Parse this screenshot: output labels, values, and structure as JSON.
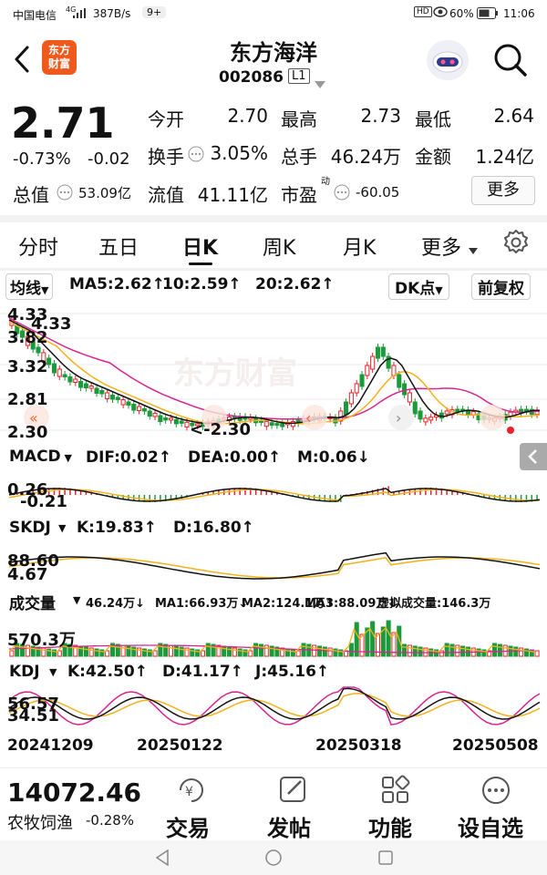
{
  "status_bar": {
    "carrier": "中国电信",
    "signal": "4G",
    "speed": "387B/s",
    "badge": "9+",
    "battery": "60%",
    "time": "11:06"
  },
  "header": {
    "logo_text": "东方\n财富",
    "title": "东方海洋",
    "code": "002086",
    "level_badge": "L1"
  },
  "quote": {
    "price": "2.71",
    "change_pct": "-0.73%",
    "change": "-0.02",
    "total_value_label": "总值",
    "total_value": "53.09亿",
    "fields": [
      {
        "label": "今开",
        "value": "2.70"
      },
      {
        "label": "最高",
        "value": "2.73"
      },
      {
        "label": "最低",
        "value": "2.64"
      },
      {
        "label": "换手",
        "value": "3.05%"
      },
      {
        "label": "总手",
        "value": "46.24万"
      },
      {
        "label": "金额",
        "value": "1.24亿"
      },
      {
        "label": "流值",
        "value": "41.11亿"
      },
      {
        "label": "市盈",
        "value": "-60.05",
        "sup": "动"
      }
    ],
    "more_label": "更多"
  },
  "tabs": [
    {
      "label": "分时"
    },
    {
      "label": "五日"
    },
    {
      "label": "日K",
      "active": true
    },
    {
      "label": "周K"
    },
    {
      "label": "月K"
    },
    {
      "label": "更多"
    }
  ],
  "kline": {
    "indicator_label": "均线",
    "ma5": "MA5:2.62↑",
    "ma10": "10:2.59↑",
    "ma20": "20:2.62↑",
    "dk_label": "DK点",
    "fq_label": "前复权",
    "y_ticks": [
      "4.33",
      "3.82",
      "3.32",
      "2.81",
      "2.30"
    ],
    "max_label": "4.33",
    "min_label": "2.30",
    "watermark": "东方财富",
    "colors": {
      "up": "#e8212a",
      "down": "#1a9a3a",
      "ma5": "#111111",
      "ma10": "#f2b21b",
      "ma20": "#d9248f"
    }
  },
  "macd": {
    "label": "MACD",
    "dif": "DIF:0.02↑",
    "dea": "DEA:0.00↑",
    "m": "M:0.06↓",
    "top": "0.26",
    "bottom": "-0.21"
  },
  "skdj": {
    "label": "SKDJ",
    "k": "K:19.83↑",
    "d": "D:16.80↑",
    "top": "88.60",
    "bottom": "4.67"
  },
  "volume": {
    "label": "成交量",
    "vol": "46.24万↓",
    "ma1": "MA1:66.93万↓",
    "ma2": "MA2:124.1万↑",
    "ma3": "MA3:88.09万↓",
    "virtual": "虚拟成交量:146.3万",
    "top": "570.3万"
  },
  "kdj": {
    "label": "KDJ",
    "k": "K:42.50↑",
    "d": "D:41.17↑",
    "j": "J:45.16↑",
    "top": "56.57",
    "bottom": "34.51"
  },
  "dates": [
    "20241209",
    "20250122",
    "20250318",
    "20250508"
  ],
  "bottom_bar": {
    "index_value": "14072.46",
    "index_name": "农牧饲渔",
    "index_change": "-0.28%",
    "actions": [
      {
        "label": "交易",
        "icon": "trade-icon"
      },
      {
        "label": "发帖",
        "icon": "edit-icon"
      },
      {
        "label": "功能",
        "icon": "grid-icon"
      },
      {
        "label": "设自选",
        "icon": "more-dots-icon"
      }
    ]
  }
}
